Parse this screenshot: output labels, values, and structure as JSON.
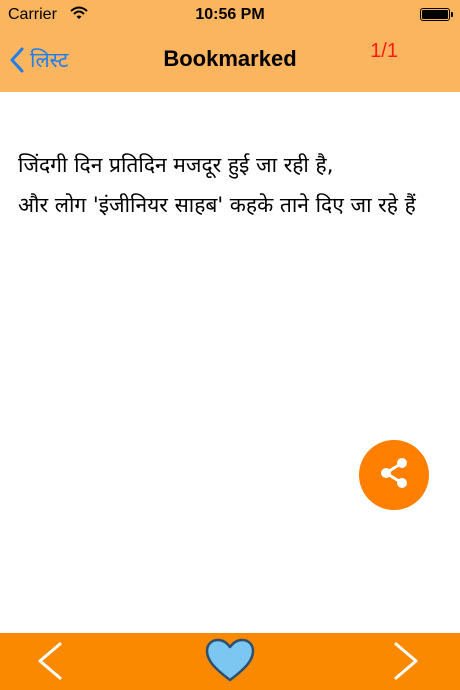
{
  "status_bar": {
    "carrier": "Carrier",
    "time": "10:56 PM"
  },
  "nav": {
    "back_label": "लिस्ट",
    "title": "Bookmarked",
    "counter": "1/1"
  },
  "content": {
    "text": "जिंदगी दिन प्रतिदिन मजदूर हुई जा रही है,\nऔर लोग 'इंजीनियर साहब' कहके ताने दिए जा रहे हैं"
  },
  "colors": {
    "header": "#fbb55f",
    "bottom_bar": "#fb8900",
    "share_button": "#ff7f00",
    "accent": "#1e7df1",
    "counter": "#ff1a1a"
  },
  "icons": [
    "wifi-icon",
    "battery-icon",
    "back-chevron-icon",
    "share-icon",
    "previous-arrow-icon",
    "heart-icon",
    "next-arrow-icon"
  ]
}
